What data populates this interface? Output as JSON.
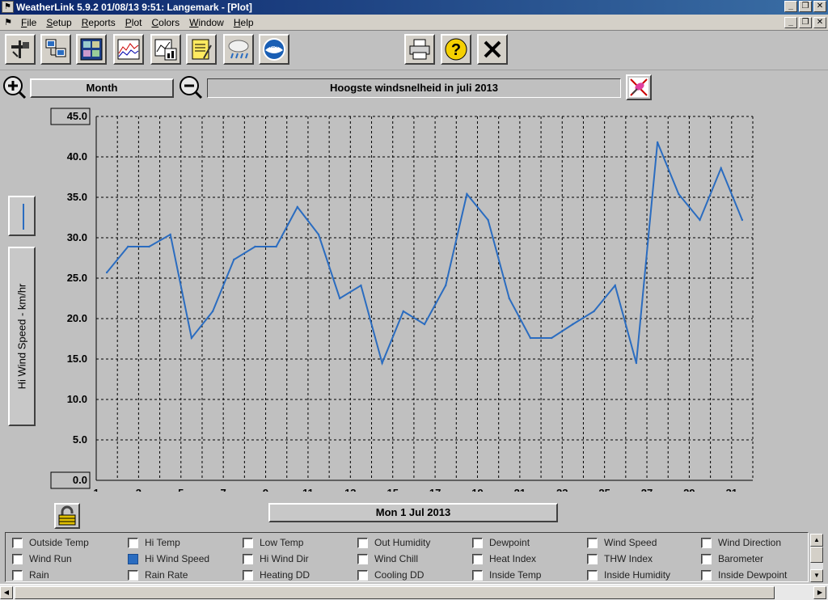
{
  "window": {
    "title": "WeatherLink 5.9.2  01/08/13   9:51: Langemark - [Plot]"
  },
  "menu": {
    "items": [
      {
        "label": "File",
        "u": "F"
      },
      {
        "label": "Setup",
        "u": "S"
      },
      {
        "label": "Reports",
        "u": "R"
      },
      {
        "label": "Plot",
        "u": "P"
      },
      {
        "label": "Colors",
        "u": "C"
      },
      {
        "label": "Window",
        "u": "W"
      },
      {
        "label": "Help",
        "u": "H"
      }
    ]
  },
  "toolbar": {
    "buttons": [
      "station-icon",
      "download-icon",
      "bulletin-icon",
      "strip-chart-icon",
      "plot-icon",
      "notes-icon",
      "rain-icon",
      "noaa-icon",
      "print-icon",
      "help-icon",
      "close-icon"
    ]
  },
  "controls": {
    "period": "Month",
    "plot_title": "Hoogste windsnelheid in juli 2013",
    "y_axis_label": "Hi Wind Speed - km/hr",
    "date": "Mon 1 Jul 2013",
    "line_color": "#2a6cc0"
  },
  "chart_data": {
    "type": "line",
    "title": "Hoogste windsnelheid in juli 2013",
    "xlabel": "",
    "ylabel": "Hi Wind Speed - km/hr",
    "ylim": [
      0,
      45
    ],
    "xlim": [
      1,
      32
    ],
    "grid": true,
    "y_ticks": [
      "45.0",
      "40.0",
      "35.0",
      "30.0",
      "25.0",
      "20.0",
      "15.0",
      "10.0",
      "5.0",
      "0.0"
    ],
    "x_ticks": [
      "1",
      "3",
      "5",
      "7",
      "9",
      "11",
      "13",
      "15",
      "17",
      "19",
      "21",
      "23",
      "25",
      "27",
      "29",
      "31"
    ],
    "series": [
      {
        "name": "Hi Wind Speed",
        "x": [
          1.5,
          2.5,
          3.5,
          4.5,
          5.5,
          6.5,
          7.5,
          8.5,
          9.5,
          10.5,
          11.5,
          12.5,
          13.5,
          14.5,
          15.5,
          16.5,
          17.5,
          18.5,
          19.5,
          20.5,
          21.5,
          22.5,
          23.5,
          24.5,
          25.5,
          26.5,
          27.5,
          28.5,
          29.5,
          30.5,
          31.5
        ],
        "values": [
          25.7,
          28.9,
          28.9,
          30.4,
          17.6,
          20.9,
          27.3,
          28.9,
          28.9,
          33.8,
          30.4,
          22.5,
          24.1,
          14.5,
          20.9,
          19.3,
          24.1,
          35.4,
          32.2,
          22.5,
          17.6,
          17.6,
          19.3,
          20.9,
          24.1,
          14.5,
          41.8,
          35.4,
          32.2,
          38.6,
          32.2
        ]
      }
    ]
  },
  "legend": {
    "items": [
      {
        "label": "Outside Temp",
        "checked": false
      },
      {
        "label": "Hi Temp",
        "checked": false
      },
      {
        "label": "Low Temp",
        "checked": false
      },
      {
        "label": "Out Humidity",
        "checked": false
      },
      {
        "label": "Dewpoint",
        "checked": false
      },
      {
        "label": "Wind Speed",
        "checked": false
      },
      {
        "label": "Wind Direction",
        "checked": false
      },
      {
        "label": "Wind Run",
        "checked": false
      },
      {
        "label": "Hi Wind Speed",
        "checked": true
      },
      {
        "label": "Hi Wind Dir",
        "checked": false
      },
      {
        "label": "Wind Chill",
        "checked": false
      },
      {
        "label": "Heat Index",
        "checked": false
      },
      {
        "label": "THW Index",
        "checked": false
      },
      {
        "label": "Barometer",
        "checked": false
      },
      {
        "label": "Rain",
        "checked": false
      },
      {
        "label": "Rain Rate",
        "checked": false
      },
      {
        "label": "Heating DD",
        "checked": false
      },
      {
        "label": "Cooling DD",
        "checked": false
      },
      {
        "label": "Inside Temp",
        "checked": false
      },
      {
        "label": "Inside Humidity",
        "checked": false
      },
      {
        "label": "Inside Dewpoint",
        "checked": false
      }
    ]
  }
}
